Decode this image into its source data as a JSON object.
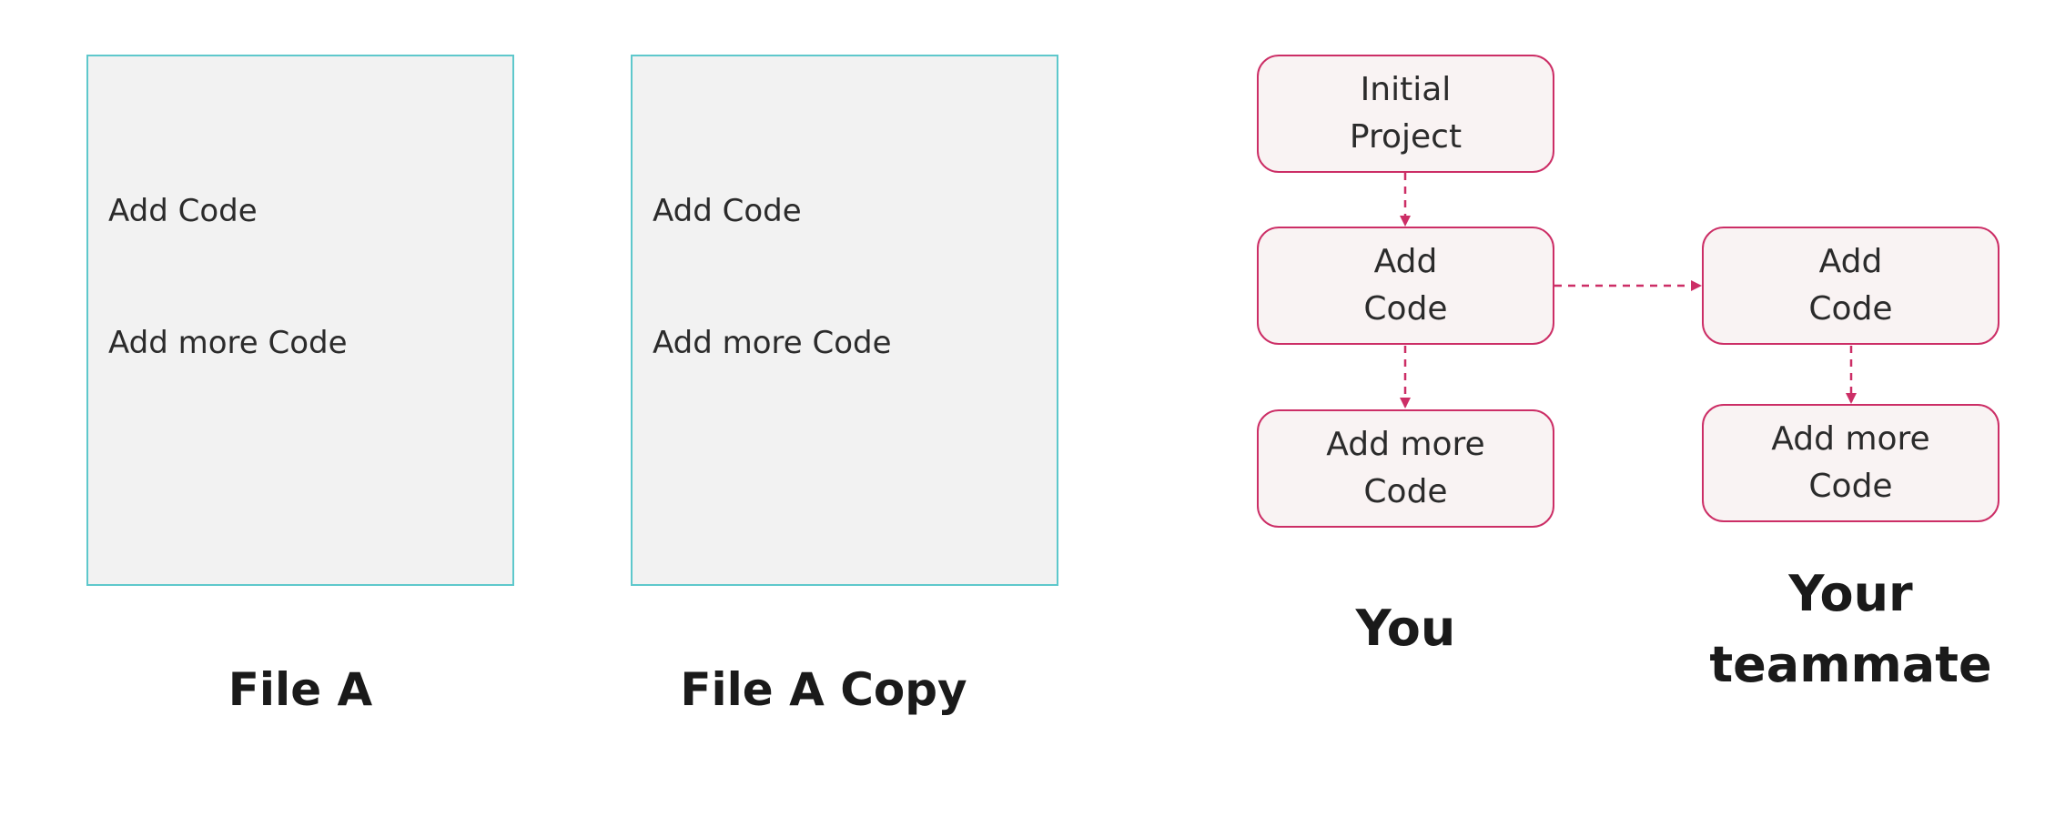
{
  "files": [
    {
      "lines": [
        "Add Code",
        "Add more Code"
      ],
      "title": "File A"
    },
    {
      "lines": [
        "Add Code",
        "Add more Code"
      ],
      "title": "File A Copy"
    }
  ],
  "history": {
    "you": {
      "label": "You",
      "nodes": [
        "Initial\nProject",
        "Add\nCode",
        "Add more\nCode"
      ]
    },
    "teammate": {
      "label": "Your\nteammate",
      "nodes": [
        "Add\nCode",
        "Add more\nCode"
      ]
    }
  },
  "colors": {
    "file_border": "#5ec8cc",
    "file_fill": "#f2f2f2",
    "node_border": "#cc2e66",
    "node_fill": "#f9f3f3",
    "arrow": "#cc2e66"
  }
}
